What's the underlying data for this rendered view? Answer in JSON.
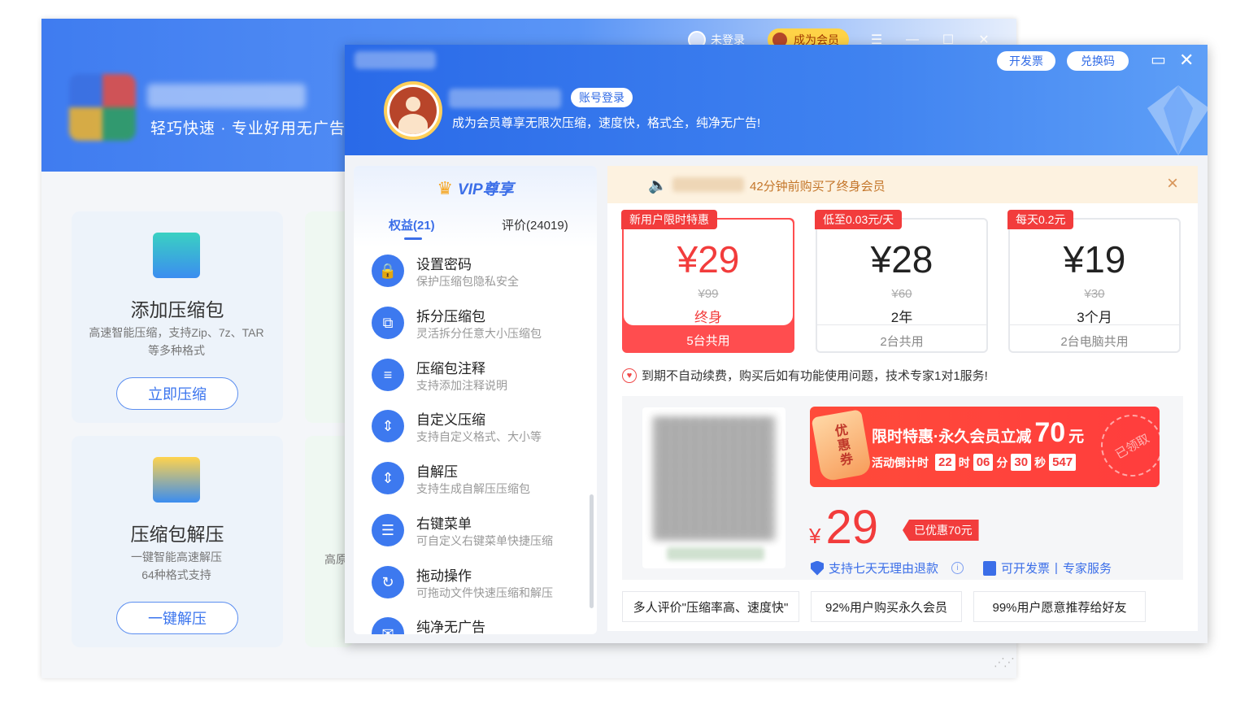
{
  "bg_app": {
    "slogan": "轻巧快速 · 专业好用无广告",
    "topbar": {
      "login": "未登录",
      "member": "成为会员",
      "menu_icon": "menu-icon",
      "min_icon": "minimize-icon",
      "max_icon": "maximize-icon",
      "close_icon": "close-icon"
    },
    "cards": [
      {
        "title": "添加压缩包",
        "desc": "高速智能压缩，支持Zip、7z、TAR等多种格式",
        "button": "立即压缩"
      },
      {
        "title": "压缩包解压",
        "desc": "一键智能高速解压\n64种格式支持",
        "button": "一键解压"
      }
    ],
    "partial_text": "高原"
  },
  "vip_window": {
    "account_login": "账号登录",
    "subtitle": "成为会员尊享无限次压缩，速度快，格式全，纯净无广告!",
    "invoice_btn": "开发票",
    "redeem_btn": "兑换码",
    "left": {
      "title": "VIP尊享",
      "tab_benefits": "权益(21)",
      "tab_reviews": "评价(24019)",
      "benefits": [
        {
          "title": "设置密码",
          "desc": "保护压缩包隐私安全",
          "icon": "lock-icon",
          "glyph": "🔒"
        },
        {
          "title": "拆分压缩包",
          "desc": "灵活拆分任意大小压缩包",
          "icon": "split-icon",
          "glyph": "⧉"
        },
        {
          "title": "压缩包注释",
          "desc": "支持添加注释说明",
          "icon": "comment-icon",
          "glyph": "≡"
        },
        {
          "title": "自定义压缩",
          "desc": "支持自定义格式、大小等",
          "icon": "custom-compress-icon",
          "glyph": "⇕"
        },
        {
          "title": "自解压",
          "desc": "支持生成自解压压缩包",
          "icon": "self-extract-icon",
          "glyph": "⇕"
        },
        {
          "title": "右键菜单",
          "desc": "可自定义右键菜单快捷压缩",
          "icon": "context-menu-icon",
          "glyph": "☰"
        },
        {
          "title": "拖动操作",
          "desc": "可拖动文件快速压缩和解压",
          "icon": "drag-icon",
          "glyph": "↻"
        },
        {
          "title": "纯净无广告",
          "desc": "",
          "icon": "no-ads-icon",
          "glyph": "✉"
        }
      ]
    },
    "notice": {
      "text": "42分钟前购买了终身会员"
    },
    "plans": [
      {
        "tag": "新用户限时特惠",
        "price": "¥29",
        "original": "¥99",
        "duration": "终身",
        "share": "5台共用",
        "selected": true
      },
      {
        "tag": "低至0.03元/天",
        "price": "¥28",
        "original": "¥60",
        "duration": "2年",
        "share": "2台共用",
        "selected": false
      },
      {
        "tag": "每天0.2元",
        "price": "¥19",
        "original": "¥30",
        "duration": "3个月",
        "share": "2台电脑共用",
        "selected": false
      }
    ],
    "guarantee": "到期不自动续费，购买后如有功能使用问题，技术专家1对1服务!",
    "coupon": {
      "badge": "优惠券",
      "title_prefix": "限时特惠·永久会员立减",
      "amount": "70",
      "unit": "元",
      "countdown_label": "活动倒计时",
      "hours": "22",
      "h": "时",
      "minutes": "06",
      "m": "分",
      "seconds": "30",
      "s": "秒",
      "ms": "547",
      "stamp": "已领取"
    },
    "pay": {
      "yen": "¥",
      "price": "29",
      "saved": "已优惠70元",
      "refund": "支持七天无理由退款",
      "invoice": "可开发票",
      "sep": "|",
      "expert": "专家服务"
    },
    "reviews": [
      "多人评价\"压缩率高、速度快\"",
      "92%用户购买永久会员",
      "99%用户愿意推荐给好友"
    ]
  }
}
